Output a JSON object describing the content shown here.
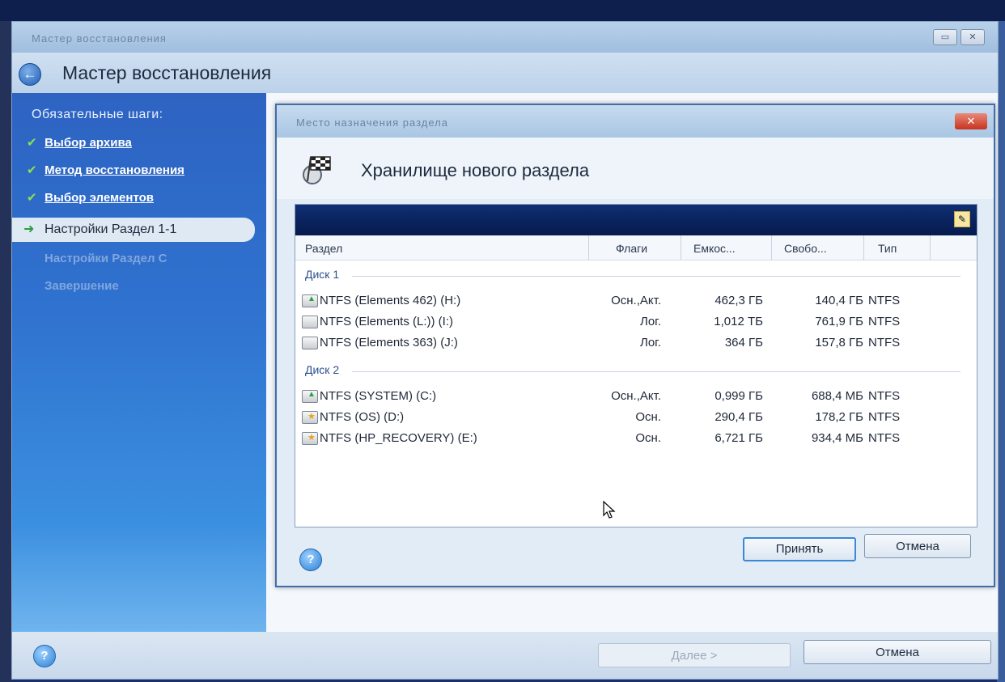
{
  "window": {
    "title": "Мастер восстановления",
    "header_title": "Мастер восстановления",
    "minimize_icon": "minimize-icon",
    "close_icon": "close-icon"
  },
  "sidebar": {
    "heading": "Обязательные шаги:",
    "steps": [
      {
        "label": "Выбор архива",
        "state": "done"
      },
      {
        "label": "Метод восстановления",
        "state": "done"
      },
      {
        "label": "Выбор элементов",
        "state": "done"
      },
      {
        "label": "Настройки Раздел 1-1",
        "state": "current"
      },
      {
        "label": "Настройки Раздел C",
        "state": "pending"
      },
      {
        "label": "Завершение",
        "state": "pending"
      }
    ]
  },
  "bottom": {
    "next_label": "Далее >",
    "cancel_label": "Отмена"
  },
  "dialog": {
    "title": "Место назначения раздела",
    "heading": "Хранилище нового раздела",
    "close_label": "✕",
    "columns": [
      "Раздел",
      "Флаги",
      "Емкос...",
      "Свобо...",
      "Тип"
    ],
    "disks": [
      {
        "label": "Диск 1",
        "partitions": [
          {
            "name": "NTFS (Elements 462) (H:)",
            "flags": "Осн.,Акт.",
            "capacity": "462,3 ГБ",
            "free": "140,4 ГБ",
            "type": "NTFS",
            "icon": "green"
          },
          {
            "name": "NTFS (Elements (L:)) (I:)",
            "flags": "Лог.",
            "capacity": "1,012 ТБ",
            "free": "761,9 ГБ",
            "type": "NTFS",
            "icon": "plain"
          },
          {
            "name": "NTFS (Elements 363) (J:)",
            "flags": "Лог.",
            "capacity": "364 ГБ",
            "free": "157,8 ГБ",
            "type": "NTFS",
            "icon": "plain"
          }
        ]
      },
      {
        "label": "Диск 2",
        "partitions": [
          {
            "name": "NTFS (SYSTEM) (C:)",
            "flags": "Осн.,Акт.",
            "capacity": "0,999 ГБ",
            "free": "688,4 МБ",
            "type": "NTFS",
            "icon": "green"
          },
          {
            "name": "NTFS (OS) (D:)",
            "flags": "Осн.",
            "capacity": "290,4 ГБ",
            "free": "178,2 ГБ",
            "type": "NTFS",
            "icon": "star"
          },
          {
            "name": "NTFS (HP_RECOVERY) (E:)",
            "flags": "Осн.",
            "capacity": "6,721 ГБ",
            "free": "934,4 МБ",
            "type": "NTFS",
            "icon": "star"
          }
        ]
      }
    ],
    "accept_label": "Принять",
    "cancel_label": "Отмена"
  },
  "colors": {
    "sidebar_top": "#2e63c2",
    "sidebar_bottom": "#6fb4ee",
    "panel_bar": "#0f2e73",
    "close_red": "#c7331d"
  }
}
